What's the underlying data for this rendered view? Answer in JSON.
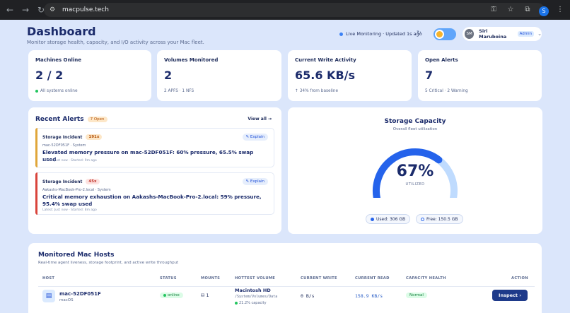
{
  "browser": {
    "url": "macpulse.tech",
    "profile_initial": "S"
  },
  "header": {
    "title": "Dashboard",
    "subtitle": "Monitor storage health, capacity, and I/O activity across your Mac fleet.",
    "live_status": "Live Monitoring · Updated 1s ago",
    "user": {
      "initials": "SM",
      "name": "Siri Maruboina",
      "role": "Admin"
    }
  },
  "stats": [
    {
      "label": "Machines Online",
      "value": "2 / 2",
      "note": "All systems online"
    },
    {
      "label": "Volumes Monitored",
      "value": "2",
      "note": "2 APFS · 1 NFS"
    },
    {
      "label": "Current Write Activity",
      "value": "65.6 KB/s",
      "note": "↑ 34% from baseline"
    },
    {
      "label": "Open Alerts",
      "value": "7",
      "note": "5 Critical · 2 Warning"
    }
  ],
  "alerts": {
    "title": "Recent Alerts",
    "open_badge": "7 Open",
    "view_all": "View all →",
    "explain_label": "Explain",
    "items": [
      {
        "type": "Storage Incident",
        "count": "191x",
        "host": "mac-52DF051F · System",
        "message": "Elevated memory pressure on mac-52DF051F: 60% pressure, 65.5% swap used",
        "meta": "Latest: Just now · Started: 9m ago",
        "color": "#e0a63a"
      },
      {
        "type": "Storage Incident",
        "count": "45x",
        "host": "Aakashs-MacBook-Pro-2.local · System",
        "message": "Critical memory exhaustion on Aakashs-MacBook-Pro-2.local: 59% pressure, 95.4% swap used",
        "meta": "Latest: Just now · Started: 8m ago",
        "color": "#d9443b"
      }
    ]
  },
  "storage": {
    "title": "Storage Capacity",
    "subtitle": "Overall fleet utilization",
    "percent": "67%",
    "fraction": 0.67,
    "util_label": "UTILIZED",
    "used": "Used: 306 GB",
    "free": "Free: 150.5 GB",
    "used_color": "#2563eb",
    "free_color": "#bfdbfe"
  },
  "hosts": {
    "title": "Monitored Mac Hosts",
    "subtitle": "Real-time agent liveness, storage footprint, and active write throughput",
    "columns": [
      "HOST",
      "STATUS",
      "MOUNTS",
      "HOTTEST VOLUME",
      "CURRENT WRITE",
      "CURRENT READ",
      "CAPACITY HEALTH",
      "ACTION"
    ],
    "rows": [
      {
        "name": "mac-52DF051F",
        "os": "macOS",
        "status": "online",
        "mounts": "1",
        "volume": "Macintosh HD",
        "volume_path": "/System/Volumes/Data",
        "volume_capacity": "21.2% capacity",
        "write": "0 B/s",
        "read": "158.9 KB/s",
        "health": "Normal",
        "action": "Inspect"
      }
    ]
  }
}
